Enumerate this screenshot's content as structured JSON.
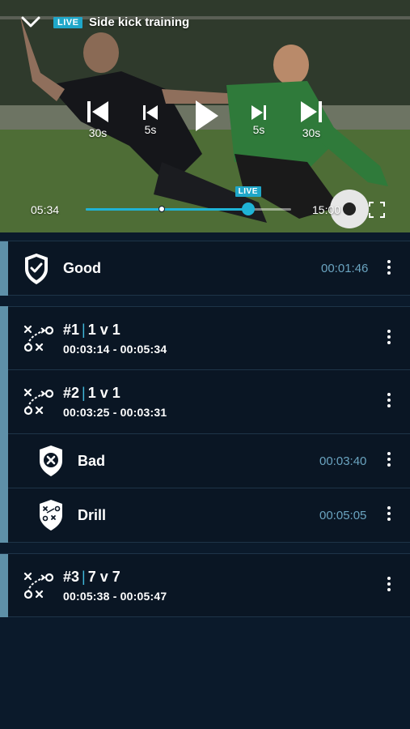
{
  "player": {
    "title": "Side kick training",
    "live_badge": "LIVE",
    "live_marker": "LIVE",
    "controls": {
      "back_30": "30s",
      "back_5": "5s",
      "fwd_5": "5s",
      "fwd_30": "30s"
    },
    "current_time": "05:34",
    "end_time": "15:00",
    "progress_fraction": 0.37,
    "live_fraction": 0.79
  },
  "colors": {
    "accent": "#1fb3d6",
    "group_bar": "#5e90a8",
    "timestamp": "#6aa4c0",
    "background": "#0b1a2b"
  },
  "items": [
    {
      "type": "tag",
      "icon": "check-shield-icon",
      "title": "Good",
      "time": "00:01:46"
    },
    {
      "type": "play",
      "icon": "tactics-icon",
      "number": "#1",
      "separator": "|",
      "label": "1 v 1",
      "range": "00:03:14 - 00:05:34"
    },
    {
      "type": "play",
      "icon": "tactics-icon",
      "number": "#2",
      "separator": "|",
      "label": "1 v 1",
      "range": "00:03:25 - 00:03:31"
    },
    {
      "type": "tag",
      "icon": "x-shield-icon",
      "title": "Bad",
      "time": "00:03:40"
    },
    {
      "type": "tag",
      "icon": "drill-shield-icon",
      "title": "Drill",
      "time": "00:05:05"
    },
    {
      "type": "play",
      "icon": "tactics-icon",
      "number": "#3",
      "separator": "|",
      "label": "7 v 7",
      "range": "00:05:38 - 00:05:47"
    }
  ]
}
